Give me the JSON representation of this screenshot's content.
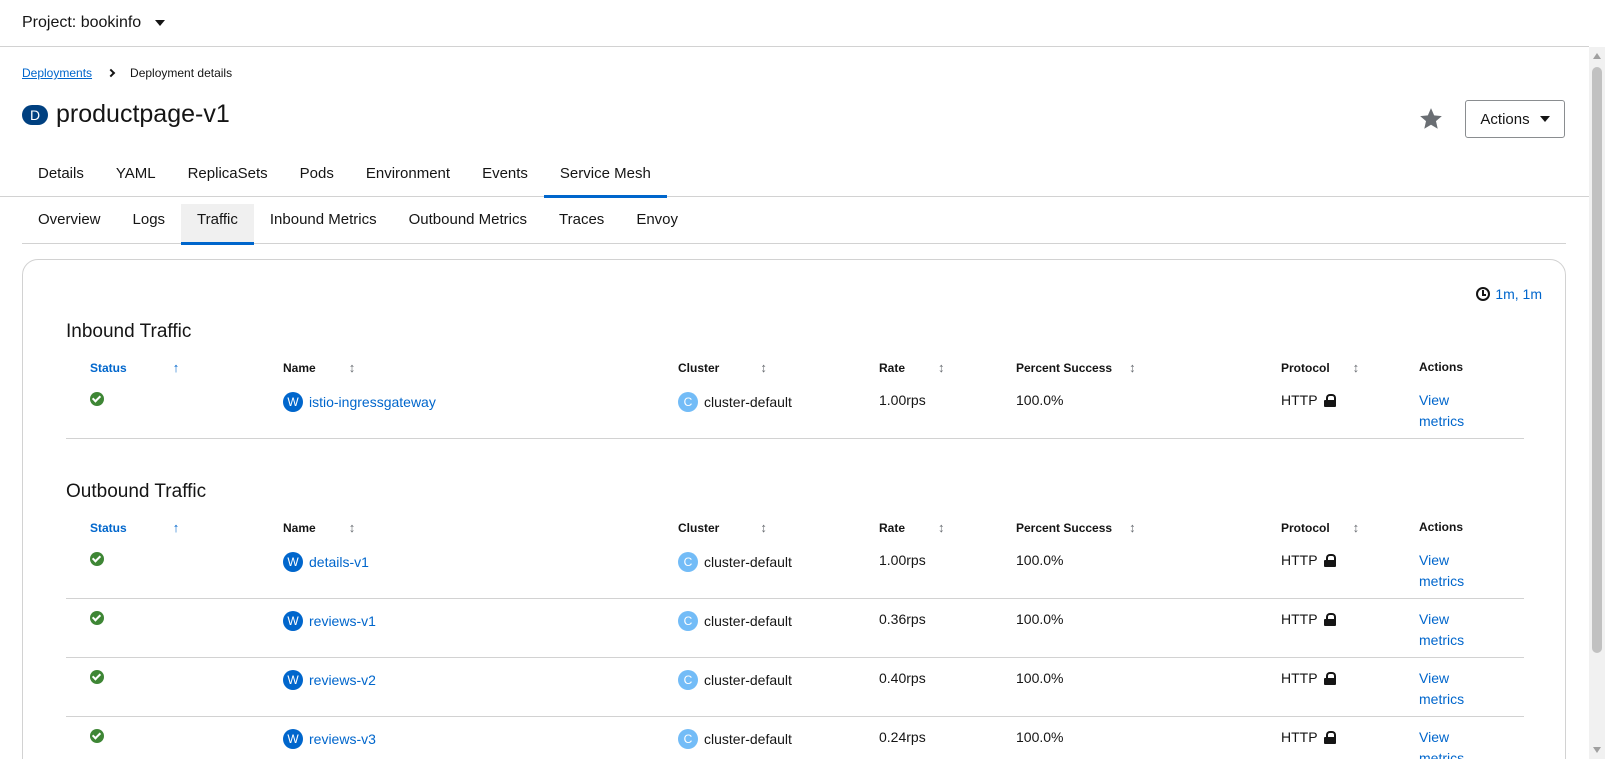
{
  "project": {
    "label": "Project: bookinfo"
  },
  "breadcrumb": {
    "parent": "Deployments",
    "current": "Deployment details"
  },
  "header": {
    "badge": "D",
    "title": "productpage-v1",
    "actions_label": "Actions"
  },
  "tabs": [
    "Details",
    "YAML",
    "ReplicaSets",
    "Pods",
    "Environment",
    "Events",
    "Service Mesh"
  ],
  "active_tab": "Service Mesh",
  "subtabs": [
    "Overview",
    "Logs",
    "Traffic",
    "Inbound Metrics",
    "Outbound Metrics",
    "Traces",
    "Envoy"
  ],
  "active_subtab": "Traffic",
  "time_range": "1m, 1m",
  "columns": {
    "status": "Status",
    "name": "Name",
    "cluster": "Cluster",
    "rate": "Rate",
    "percent_success": "Percent Success",
    "protocol": "Protocol",
    "actions": "Actions"
  },
  "inbound": {
    "title": "Inbound Traffic",
    "rows": [
      {
        "name": "istio-ingressgateway",
        "name_badge": "W",
        "cluster": "cluster-default",
        "cluster_badge": "C",
        "rate": "1.00rps",
        "success": "100.0%",
        "protocol": "HTTP",
        "action": "View metrics"
      }
    ]
  },
  "outbound": {
    "title": "Outbound Traffic",
    "rows": [
      {
        "name": "details-v1",
        "name_badge": "W",
        "cluster": "cluster-default",
        "cluster_badge": "C",
        "rate": "1.00rps",
        "success": "100.0%",
        "protocol": "HTTP",
        "action": "View metrics"
      },
      {
        "name": "reviews-v1",
        "name_badge": "W",
        "cluster": "cluster-default",
        "cluster_badge": "C",
        "rate": "0.36rps",
        "success": "100.0%",
        "protocol": "HTTP",
        "action": "View metrics"
      },
      {
        "name": "reviews-v2",
        "name_badge": "W",
        "cluster": "cluster-default",
        "cluster_badge": "C",
        "rate": "0.40rps",
        "success": "100.0%",
        "protocol": "HTTP",
        "action": "View metrics"
      },
      {
        "name": "reviews-v3",
        "name_badge": "W",
        "cluster": "cluster-default",
        "cluster_badge": "C",
        "rate": "0.24rps",
        "success": "100.0%",
        "protocol": "HTTP",
        "action": "View metrics"
      }
    ]
  },
  "colors": {
    "accent": "#0066cc",
    "success": "#3e8635",
    "title_badge": "#004080",
    "cluster_badge": "#73bcf7"
  }
}
